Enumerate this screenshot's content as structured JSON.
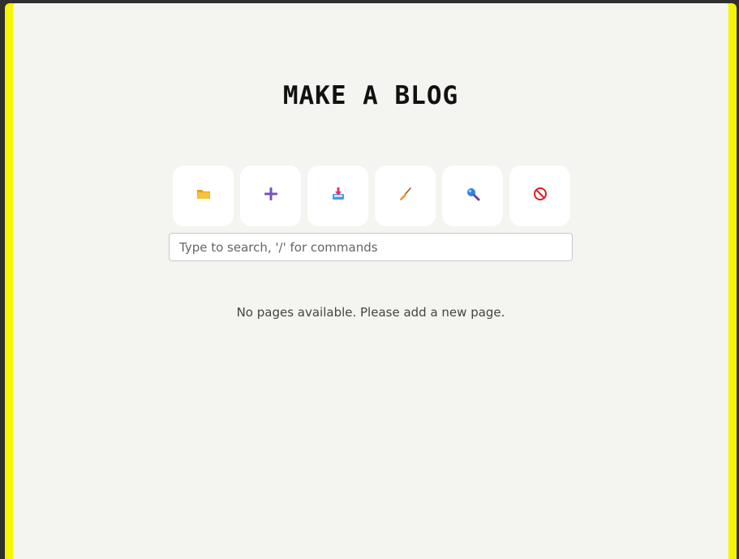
{
  "header": {
    "title": "MAKE A BLOG"
  },
  "toolbar": {
    "buttons": [
      {
        "icon": "folder-icon",
        "color": "#f6b51e"
      },
      {
        "icon": "plus-icon",
        "color": "#7a4fc2"
      },
      {
        "icon": "download-tray-icon",
        "color": "#e2307a"
      },
      {
        "icon": "broom-icon",
        "color": "#d7792b"
      },
      {
        "icon": "magnifier-icon",
        "color": "#1f6fd6"
      },
      {
        "icon": "no-entry-icon",
        "color": "#e01b24"
      }
    ]
  },
  "search": {
    "placeholder": "Type to search, '/' for commands",
    "value": ""
  },
  "main": {
    "empty_message": "No pages available. Please add a new page."
  },
  "theme": {
    "accent": "#f6f600",
    "background": "#f4f4f0"
  }
}
